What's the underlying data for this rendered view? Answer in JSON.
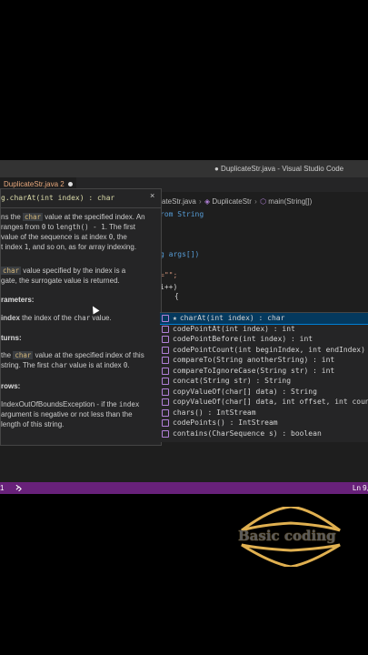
{
  "titlebar": {
    "title": "● DuplicateStr.java - Visual Studio Code"
  },
  "tabs": {
    "active": "DuplicateStr.java 2"
  },
  "breadcrumb": {
    "file": "cateStr.java",
    "cls": "DuplicateStr",
    "method": "main(String[])"
  },
  "code": {
    "line1": "rom String",
    "line2": "g args[])",
    "line3": "=\"\";",
    "line4": "i++)",
    "line5": "{"
  },
  "hover": {
    "signature": "g.charAt(int index) : char",
    "close": "×",
    "p1": {
      "a": "ns the ",
      "c1": "char",
      "b": " value at the specified index. An",
      "c": "ranges from ",
      "c2": "0",
      "d": " to ",
      "c3": "length() - 1",
      "e": ". The first",
      "f": " value of the sequence is at index ",
      "c4": "0",
      "g": ", the",
      "h": "t index ",
      "c5": "1",
      "i": ", and so on, as for array indexing."
    },
    "p2": {
      "c1": "char",
      "a": " value specified by the index is a",
      "b": "gate, the surrogate value is returned."
    },
    "params_h": "rameters:",
    "param": {
      "name": "index",
      "desc": " the index of the ",
      "c1": "char",
      "end": " value."
    },
    "returns_h": "turns:",
    "ret": {
      "a": "the ",
      "c1": "char",
      "b": " value at the specified index of this",
      "c": "string. The first ",
      "c2": "char",
      "d": " value is at index ",
      "c3": "0",
      "e": "."
    },
    "throws_h": "rows:",
    "thr": {
      "a": "IndexOutOfBoundsException - if the ",
      "c1": "index",
      "b": "argument is negative or not less than the",
      "c": "length of this string."
    }
  },
  "suggest": [
    {
      "label": "charAt(int index) : char",
      "starred": true
    },
    {
      "label": "codePointAt(int index) : int"
    },
    {
      "label": "codePointBefore(int index) : int"
    },
    {
      "label": "codePointCount(int beginIndex, int endIndex) :"
    },
    {
      "label": "compareTo(String anotherString) : int"
    },
    {
      "label": "compareToIgnoreCase(String str) : int"
    },
    {
      "label": "concat(String str) : String"
    },
    {
      "label": "copyValueOf(char[] data) : String"
    },
    {
      "label": "copyValueOf(char[] data, int offset, int count"
    },
    {
      "label": "chars() : IntStream"
    },
    {
      "label": "codePoints() : IntStream"
    },
    {
      "label": "contains(CharSequence s) : boolean"
    }
  ],
  "status": {
    "left": "1",
    "right": "Ln 9,"
  },
  "logo": {
    "text": "Basic coding"
  },
  "icons": {
    "suggest": "method-cube-icon",
    "status": "remote-icon"
  }
}
